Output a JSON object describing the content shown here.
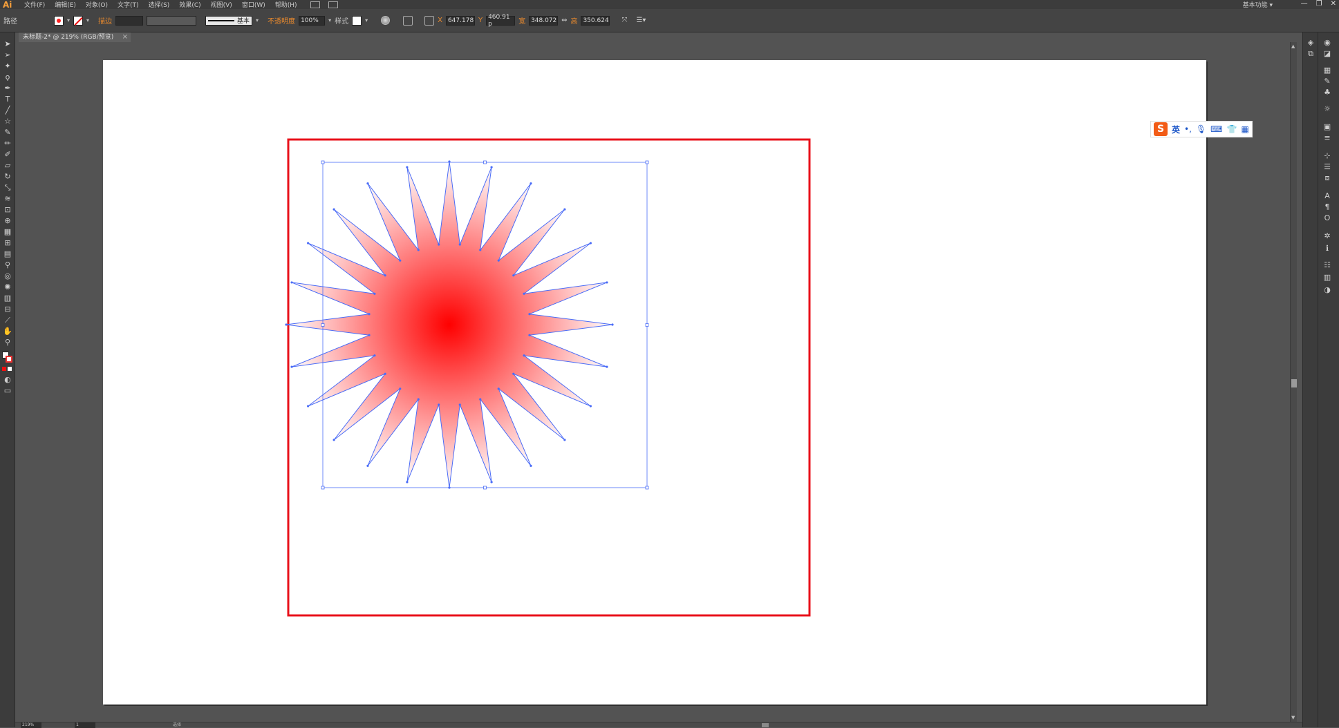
{
  "app": {
    "logo": "Ai",
    "workspace": "基本功能 ▾",
    "window_controls": [
      "—",
      "❐",
      "✕"
    ]
  },
  "menu": [
    "文件(F)",
    "编辑(E)",
    "对象(O)",
    "文字(T)",
    "选择(S)",
    "效果(C)",
    "视图(V)",
    "窗口(W)",
    "帮助(H)"
  ],
  "control": {
    "object_type": "路径",
    "stroke_label": "描边",
    "stroke_profile": "基本",
    "opacity_label": "不透明度",
    "opacity_value": "100%",
    "style_label": "样式",
    "x_label": "X",
    "x_value": "647.178",
    "y_label": "Y",
    "y_value": "460.91 p",
    "w_label": "宽",
    "w_value": "348.072",
    "h_label": "高",
    "h_value": "350.624"
  },
  "document": {
    "tab_title": "未标题-2* @ 219% (RGB/预览)",
    "close": "×"
  },
  "ime": {
    "logo": "S",
    "lang": "英",
    "icons": [
      "punctuation-icon",
      "microphone-icon",
      "keyboard-icon",
      "skin-icon",
      "toolbox-icon"
    ]
  },
  "status": {
    "zoom": "219%",
    "page": "1",
    "text": "选择"
  },
  "artwork": {
    "shape": "star",
    "points": 24,
    "fill": "radial-gradient",
    "gradient_center_color": "#ff0000",
    "gradient_edge_color": "#ffffff",
    "selection_color": "#4a6cf7",
    "frame_color": "#e8101a"
  }
}
